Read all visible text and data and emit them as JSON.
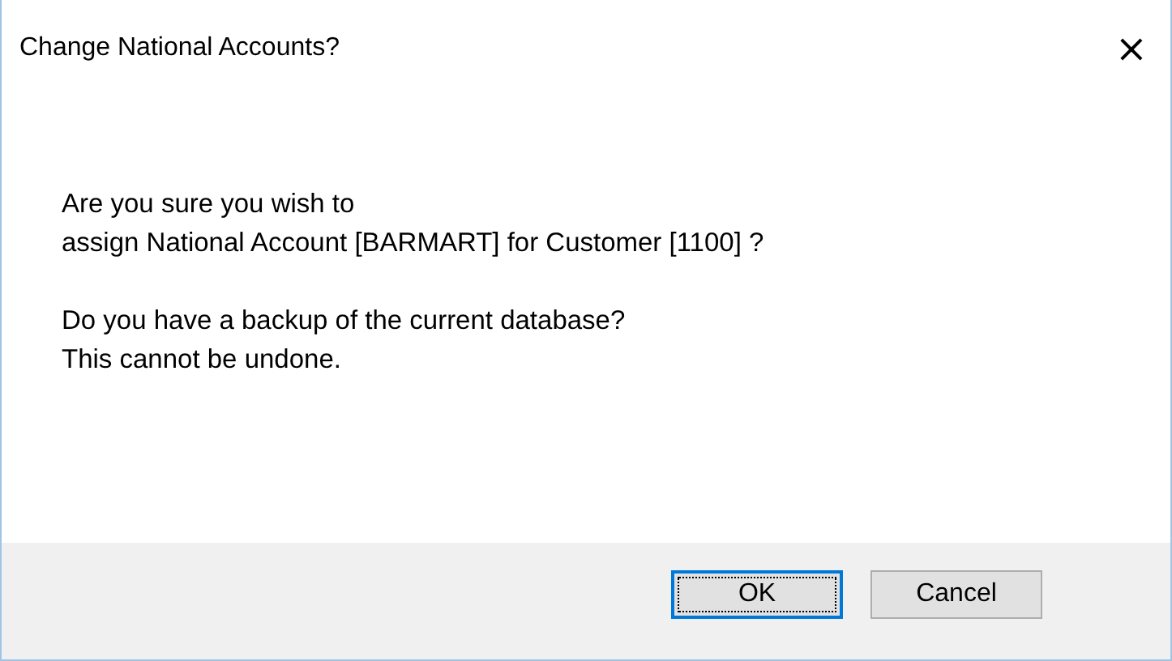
{
  "window": {
    "title": "Change National Accounts?",
    "close": "×"
  },
  "message": {
    "lines": [
      "Are you sure you wish to",
      "assign National Account [BARMART] for Customer [1100] ?"
    ]
  },
  "warning": {
    "lines": [
      "Do you have a backup of the current database?",
      "This cannot be undone."
    ]
  },
  "buttons": [
    {
      "label": "OK",
      "focused": true
    },
    {
      "label": "Cancel",
      "focused": false
    }
  ]
}
